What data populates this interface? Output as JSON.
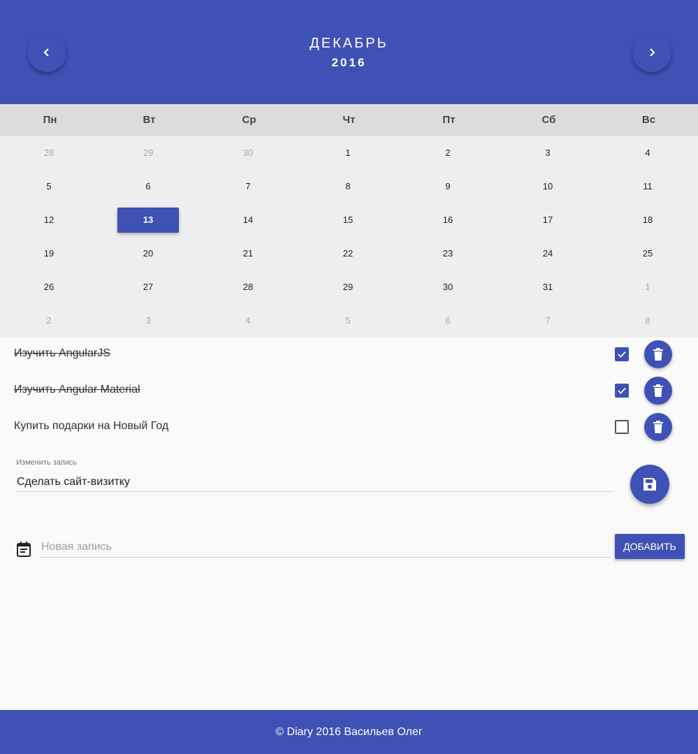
{
  "header": {
    "month": "ДЕКАБРЬ",
    "year": "2016",
    "prev_icon": "chevron-left-icon",
    "next_icon": "chevron-right-icon"
  },
  "calendar": {
    "weekdays": [
      "Пн",
      "Вт",
      "Ср",
      "Чт",
      "Пт",
      "Сб",
      "Вс"
    ],
    "selected_day": "13",
    "weeks": [
      [
        {
          "d": "28",
          "other": true
        },
        {
          "d": "29",
          "other": true
        },
        {
          "d": "30",
          "other": true
        },
        {
          "d": "1"
        },
        {
          "d": "2"
        },
        {
          "d": "3"
        },
        {
          "d": "4"
        }
      ],
      [
        {
          "d": "5"
        },
        {
          "d": "6"
        },
        {
          "d": "7"
        },
        {
          "d": "8"
        },
        {
          "d": "9"
        },
        {
          "d": "10"
        },
        {
          "d": "11"
        }
      ],
      [
        {
          "d": "12"
        },
        {
          "d": "13",
          "selected": true
        },
        {
          "d": "14"
        },
        {
          "d": "15"
        },
        {
          "d": "16"
        },
        {
          "d": "17"
        },
        {
          "d": "18"
        }
      ],
      [
        {
          "d": "19"
        },
        {
          "d": "20"
        },
        {
          "d": "21"
        },
        {
          "d": "22"
        },
        {
          "d": "23"
        },
        {
          "d": "24"
        },
        {
          "d": "25"
        }
      ],
      [
        {
          "d": "26"
        },
        {
          "d": "27"
        },
        {
          "d": "28"
        },
        {
          "d": "29"
        },
        {
          "d": "30"
        },
        {
          "d": "31"
        },
        {
          "d": "1",
          "other": true
        }
      ],
      [
        {
          "d": "2",
          "other": true
        },
        {
          "d": "3",
          "other": true
        },
        {
          "d": "4",
          "other": true
        },
        {
          "d": "5",
          "other": true
        },
        {
          "d": "6",
          "other": true
        },
        {
          "d": "7",
          "other": true
        },
        {
          "d": "8",
          "other": true
        }
      ]
    ]
  },
  "tasks": [
    {
      "text": "Изучить AngularJS",
      "done": true
    },
    {
      "text": "Изучить Angular Material",
      "done": true
    },
    {
      "text": "Купить подарки на Новый Год",
      "done": false
    }
  ],
  "edit": {
    "label": "Изменить запись",
    "value": "Сделать сайт-визитку",
    "save_icon": "save-icon"
  },
  "new_entry": {
    "placeholder": "Новая запись",
    "add_label": "ДОБАВИТЬ",
    "icon": "calendar-note-icon"
  },
  "footer": {
    "text": "© Diary 2016 Васильев Олег"
  },
  "colors": {
    "primary": "#3f51b5",
    "weekday_bg": "#dcdcdc",
    "days_bg": "#eeeeee",
    "page_bg": "#fafafa"
  }
}
